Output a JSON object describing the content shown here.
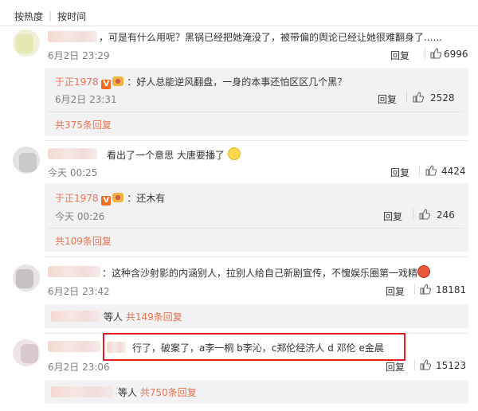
{
  "sort": {
    "hot": "按热度",
    "time": "按时间"
  },
  "comments": [
    {
      "text": "，可是有什么用呢？黑锅已经把她淹没了，被带偏的舆论已经让她很难翻身了......",
      "time": "6月2日 23:29",
      "reply_label": "回复",
      "likes": "6996",
      "sub_reply": {
        "user": "于正1978",
        "text": "：好人总能逆风翻盘，一身的本事还怕区区几个黑？",
        "time": "6月2日 23:31",
        "reply_label": "回复",
        "likes": "2528"
      },
      "more": "共375条回复"
    },
    {
      "text": "看出了一个意思  大唐要播了",
      "time": "今天 00:25",
      "reply_label": "回复",
      "likes": "4424",
      "sub_reply": {
        "user": "于正1978",
        "text": "：还木有",
        "time": "今天 00:26",
        "reply_label": "回复",
        "likes": "246"
      },
      "more": "共109条回复"
    },
    {
      "text": "：这种含沙射影的内涵别人，拉别人给自己新剧宣传，不愧娱乐圈第一戏精",
      "time": "6月2日 23:42",
      "reply_label": "回复",
      "likes": "18181",
      "replies_summary": {
        "prefix": "等人",
        "more": "共149条回复"
      }
    },
    {
      "text": "行了，破案了，a李一桐 b李沁，c郑伦经济人 d 邓伦  e金晨",
      "time": "6月2日 23:06",
      "reply_label": "回复",
      "likes": "15123",
      "replies_summary": {
        "prefix": "等人",
        "more": "共750条回复"
      }
    }
  ],
  "colors": {
    "link": "#eb7350",
    "highlight": "#e02020",
    "reply_bg": "#f2f2f5"
  }
}
